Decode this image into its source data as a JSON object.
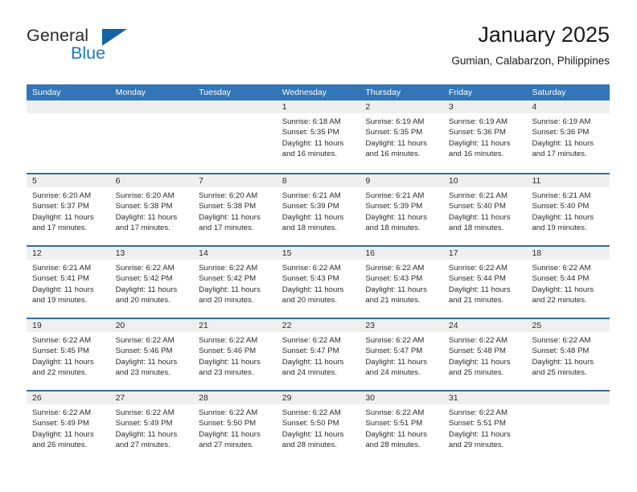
{
  "logo": {
    "text_top": "General",
    "text_bottom": "Blue",
    "accent_color": "#1878c8",
    "triangle_color": "#1464a5"
  },
  "header": {
    "title": "January 2025",
    "subtitle": "Gumian, Calabarzon, Philippines"
  },
  "theme": {
    "header_band": "#3275b8",
    "week_divider": "#2e6da9",
    "daynum_band": "#efefef",
    "text": "#2b2b2b"
  },
  "weekdays": [
    "Sunday",
    "Monday",
    "Tuesday",
    "Wednesday",
    "Thursday",
    "Friday",
    "Saturday"
  ],
  "weeks": [
    [
      {
        "day": "",
        "lines": []
      },
      {
        "day": "",
        "lines": []
      },
      {
        "day": "",
        "lines": []
      },
      {
        "day": "1",
        "lines": [
          "Sunrise: 6:18 AM",
          "Sunset: 5:35 PM",
          "Daylight: 11 hours",
          "and 16 minutes."
        ]
      },
      {
        "day": "2",
        "lines": [
          "Sunrise: 6:19 AM",
          "Sunset: 5:35 PM",
          "Daylight: 11 hours",
          "and 16 minutes."
        ]
      },
      {
        "day": "3",
        "lines": [
          "Sunrise: 6:19 AM",
          "Sunset: 5:36 PM",
          "Daylight: 11 hours",
          "and 16 minutes."
        ]
      },
      {
        "day": "4",
        "lines": [
          "Sunrise: 6:19 AM",
          "Sunset: 5:36 PM",
          "Daylight: 11 hours",
          "and 17 minutes."
        ]
      }
    ],
    [
      {
        "day": "5",
        "lines": [
          "Sunrise: 6:20 AM",
          "Sunset: 5:37 PM",
          "Daylight: 11 hours",
          "and 17 minutes."
        ]
      },
      {
        "day": "6",
        "lines": [
          "Sunrise: 6:20 AM",
          "Sunset: 5:38 PM",
          "Daylight: 11 hours",
          "and 17 minutes."
        ]
      },
      {
        "day": "7",
        "lines": [
          "Sunrise: 6:20 AM",
          "Sunset: 5:38 PM",
          "Daylight: 11 hours",
          "and 17 minutes."
        ]
      },
      {
        "day": "8",
        "lines": [
          "Sunrise: 6:21 AM",
          "Sunset: 5:39 PM",
          "Daylight: 11 hours",
          "and 18 minutes."
        ]
      },
      {
        "day": "9",
        "lines": [
          "Sunrise: 6:21 AM",
          "Sunset: 5:39 PM",
          "Daylight: 11 hours",
          "and 18 minutes."
        ]
      },
      {
        "day": "10",
        "lines": [
          "Sunrise: 6:21 AM",
          "Sunset: 5:40 PM",
          "Daylight: 11 hours",
          "and 18 minutes."
        ]
      },
      {
        "day": "11",
        "lines": [
          "Sunrise: 6:21 AM",
          "Sunset: 5:40 PM",
          "Daylight: 11 hours",
          "and 19 minutes."
        ]
      }
    ],
    [
      {
        "day": "12",
        "lines": [
          "Sunrise: 6:21 AM",
          "Sunset: 5:41 PM",
          "Daylight: 11 hours",
          "and 19 minutes."
        ]
      },
      {
        "day": "13",
        "lines": [
          "Sunrise: 6:22 AM",
          "Sunset: 5:42 PM",
          "Daylight: 11 hours",
          "and 20 minutes."
        ]
      },
      {
        "day": "14",
        "lines": [
          "Sunrise: 6:22 AM",
          "Sunset: 5:42 PM",
          "Daylight: 11 hours",
          "and 20 minutes."
        ]
      },
      {
        "day": "15",
        "lines": [
          "Sunrise: 6:22 AM",
          "Sunset: 5:43 PM",
          "Daylight: 11 hours",
          "and 20 minutes."
        ]
      },
      {
        "day": "16",
        "lines": [
          "Sunrise: 6:22 AM",
          "Sunset: 5:43 PM",
          "Daylight: 11 hours",
          "and 21 minutes."
        ]
      },
      {
        "day": "17",
        "lines": [
          "Sunrise: 6:22 AM",
          "Sunset: 5:44 PM",
          "Daylight: 11 hours",
          "and 21 minutes."
        ]
      },
      {
        "day": "18",
        "lines": [
          "Sunrise: 6:22 AM",
          "Sunset: 5:44 PM",
          "Daylight: 11 hours",
          "and 22 minutes."
        ]
      }
    ],
    [
      {
        "day": "19",
        "lines": [
          "Sunrise: 6:22 AM",
          "Sunset: 5:45 PM",
          "Daylight: 11 hours",
          "and 22 minutes."
        ]
      },
      {
        "day": "20",
        "lines": [
          "Sunrise: 6:22 AM",
          "Sunset: 5:46 PM",
          "Daylight: 11 hours",
          "and 23 minutes."
        ]
      },
      {
        "day": "21",
        "lines": [
          "Sunrise: 6:22 AM",
          "Sunset: 5:46 PM",
          "Daylight: 11 hours",
          "and 23 minutes."
        ]
      },
      {
        "day": "22",
        "lines": [
          "Sunrise: 6:22 AM",
          "Sunset: 5:47 PM",
          "Daylight: 11 hours",
          "and 24 minutes."
        ]
      },
      {
        "day": "23",
        "lines": [
          "Sunrise: 6:22 AM",
          "Sunset: 5:47 PM",
          "Daylight: 11 hours",
          "and 24 minutes."
        ]
      },
      {
        "day": "24",
        "lines": [
          "Sunrise: 6:22 AM",
          "Sunset: 5:48 PM",
          "Daylight: 11 hours",
          "and 25 minutes."
        ]
      },
      {
        "day": "25",
        "lines": [
          "Sunrise: 6:22 AM",
          "Sunset: 5:48 PM",
          "Daylight: 11 hours",
          "and 25 minutes."
        ]
      }
    ],
    [
      {
        "day": "26",
        "lines": [
          "Sunrise: 6:22 AM",
          "Sunset: 5:49 PM",
          "Daylight: 11 hours",
          "and 26 minutes."
        ]
      },
      {
        "day": "27",
        "lines": [
          "Sunrise: 6:22 AM",
          "Sunset: 5:49 PM",
          "Daylight: 11 hours",
          "and 27 minutes."
        ]
      },
      {
        "day": "28",
        "lines": [
          "Sunrise: 6:22 AM",
          "Sunset: 5:50 PM",
          "Daylight: 11 hours",
          "and 27 minutes."
        ]
      },
      {
        "day": "29",
        "lines": [
          "Sunrise: 6:22 AM",
          "Sunset: 5:50 PM",
          "Daylight: 11 hours",
          "and 28 minutes."
        ]
      },
      {
        "day": "30",
        "lines": [
          "Sunrise: 6:22 AM",
          "Sunset: 5:51 PM",
          "Daylight: 11 hours",
          "and 28 minutes."
        ]
      },
      {
        "day": "31",
        "lines": [
          "Sunrise: 6:22 AM",
          "Sunset: 5:51 PM",
          "Daylight: 11 hours",
          "and 29 minutes."
        ]
      },
      {
        "day": "",
        "lines": []
      }
    ]
  ]
}
